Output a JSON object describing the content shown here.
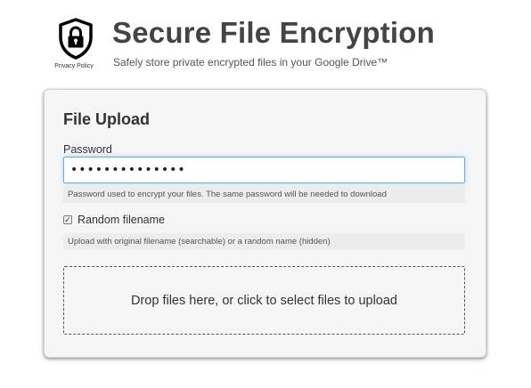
{
  "header": {
    "title": "Secure File Encryption",
    "subtitle": "Safely store private encrypted files in your Google Drive™",
    "privacy_link": "Privacy Policy",
    "logo_icon": "shield-lock-icon"
  },
  "upload": {
    "heading": "File Upload",
    "password_label": "Password",
    "password_value": "••••••••••••••",
    "password_help": "Password used to encrypt your files. The same password will be needed to download",
    "random_filename_label": "Random filename",
    "random_filename_checked": true,
    "random_filename_help": "Upload with original filename (searchable) or a random name (hidden)",
    "dropzone_text": "Drop files here, or click to select files to upload"
  },
  "colors": {
    "focus_border": "#66afe9",
    "title_text": "#444444",
    "card_bg": "#f5f5f5"
  }
}
